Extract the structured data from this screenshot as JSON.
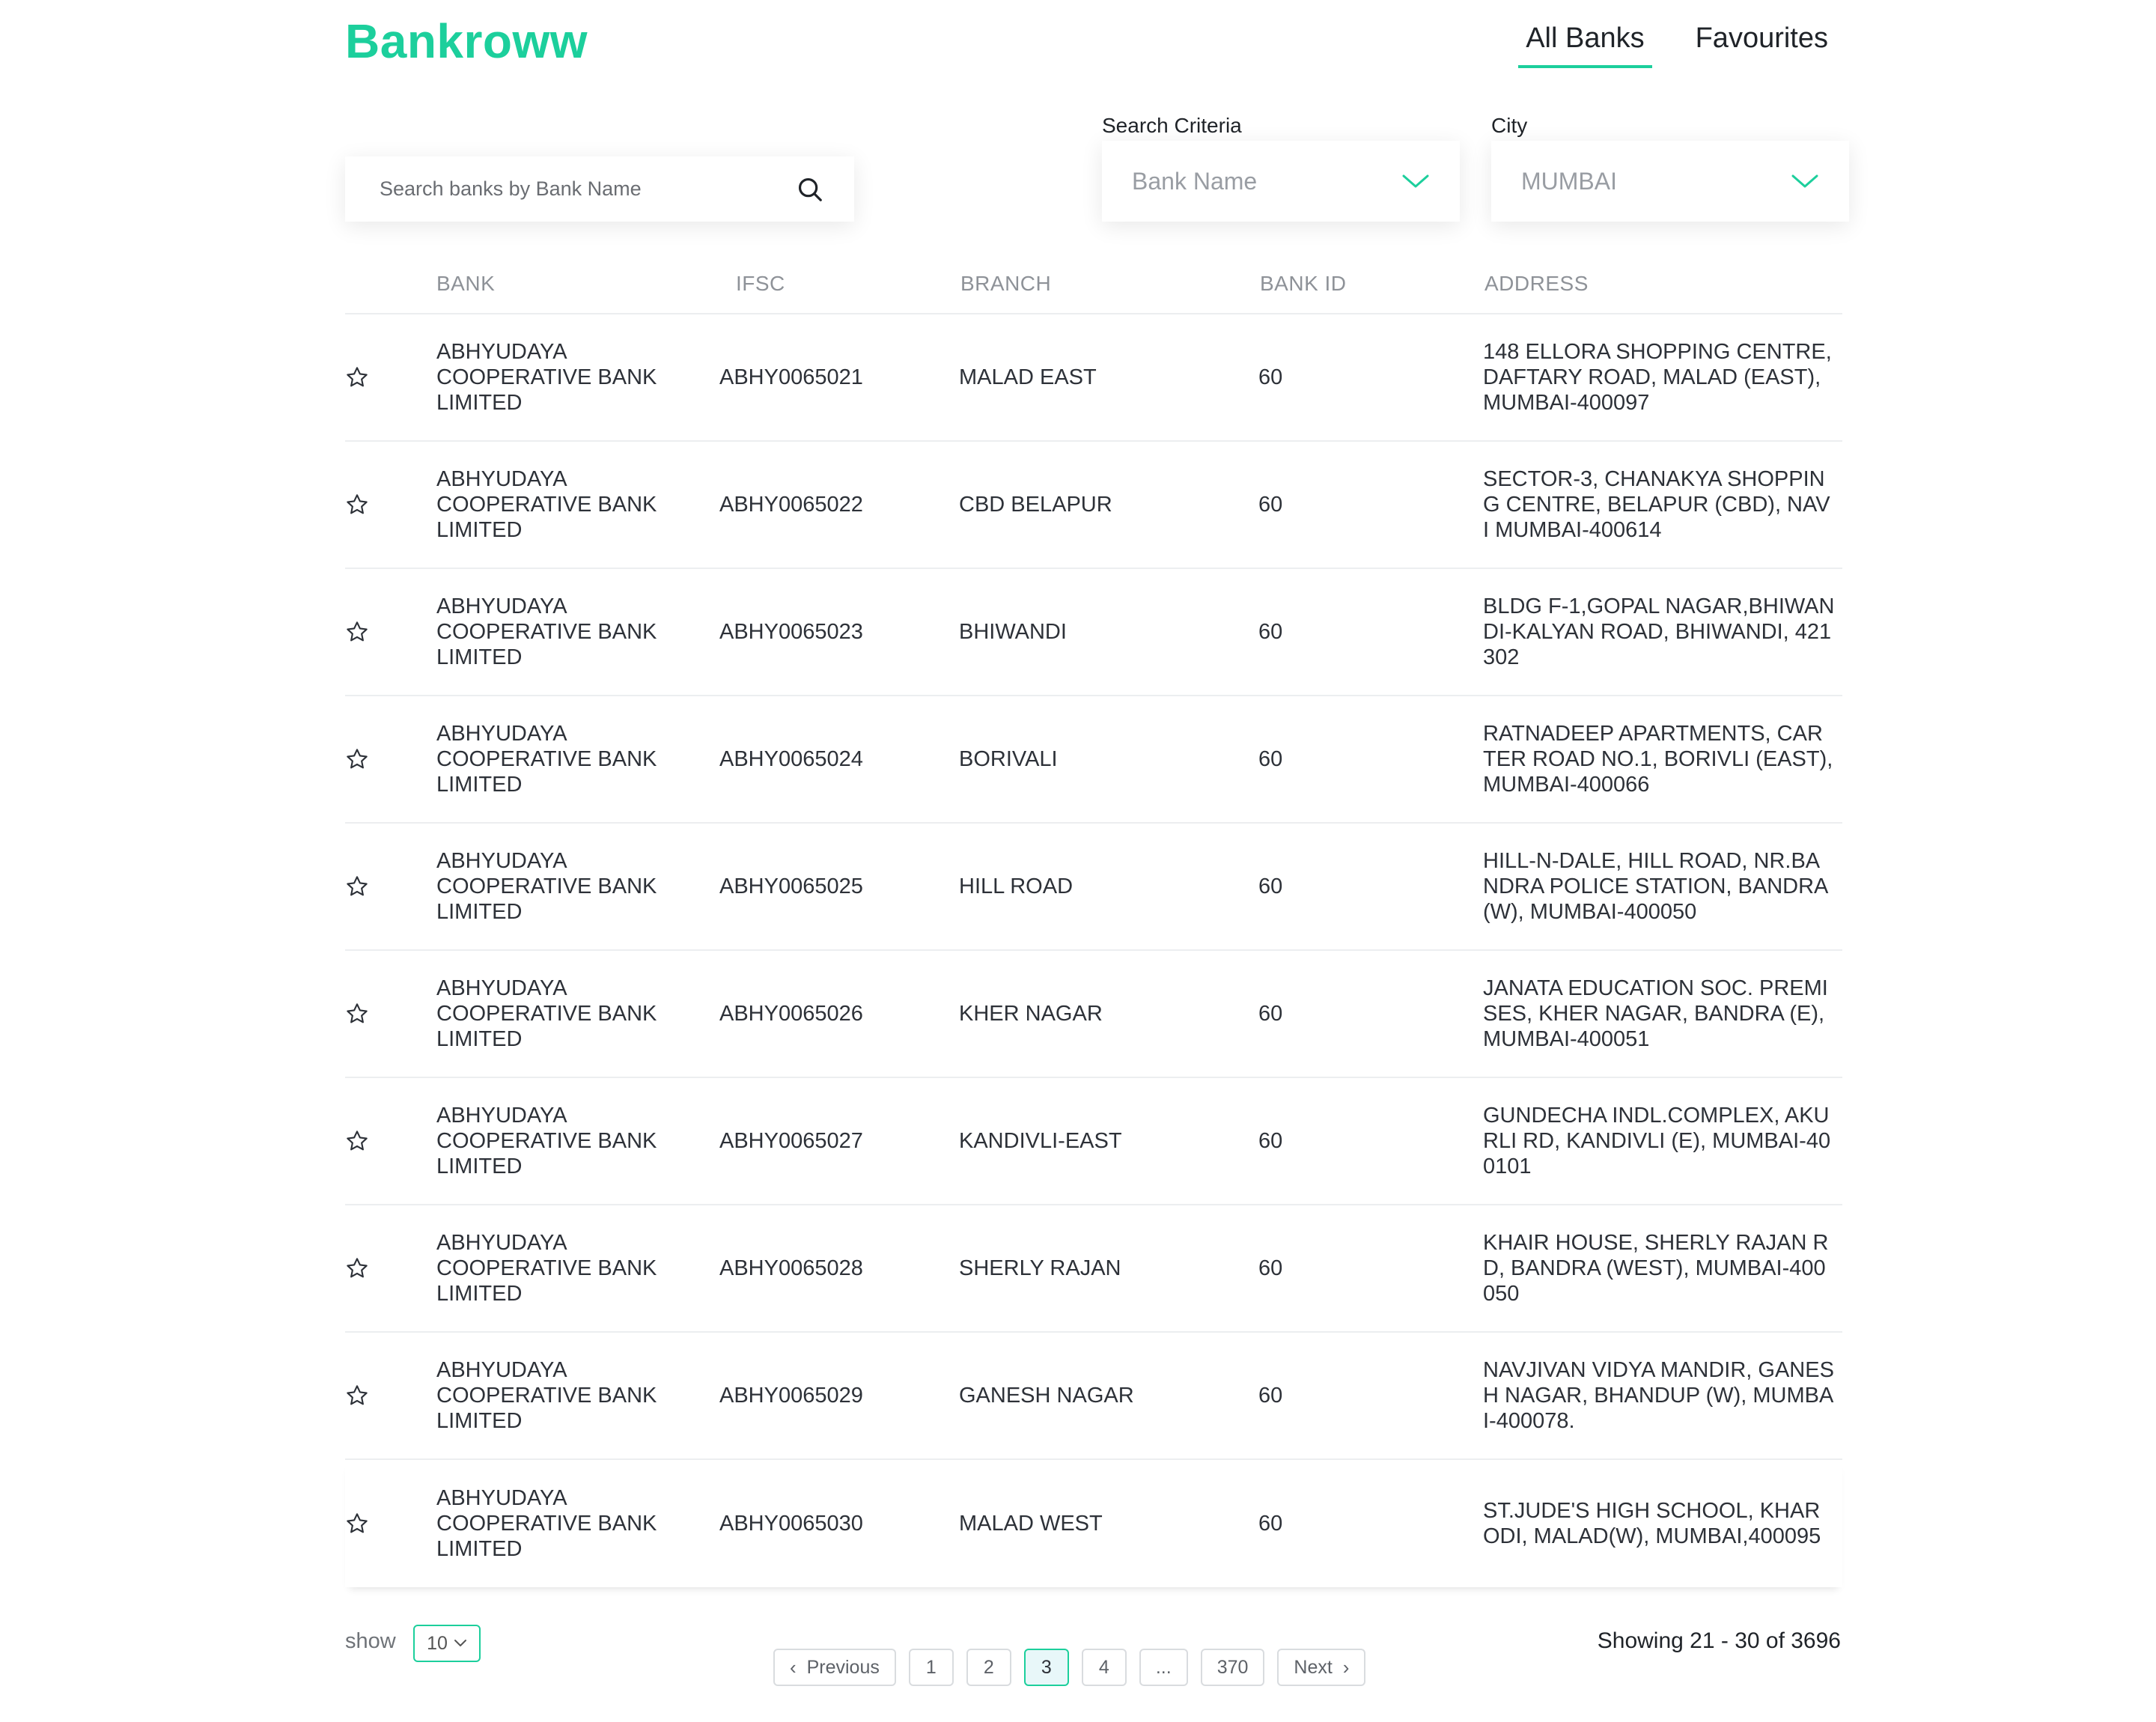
{
  "brand": "Bankroww",
  "nav": {
    "all_banks": "All Banks",
    "favourites": "Favourites"
  },
  "search": {
    "placeholder": "Search banks by Bank Name"
  },
  "filters": {
    "criteria_label": "Search Criteria",
    "criteria_value": "Bank Name",
    "city_label": "City",
    "city_value": "MUMBAI"
  },
  "table": {
    "headers": {
      "bank": "BANK",
      "ifsc": "IFSC",
      "branch": "BRANCH",
      "bank_id": "BANK ID",
      "address": "ADDRESS"
    },
    "rows": [
      {
        "bank": "ABHYUDAYA COOPERATIVE BANK LIMITED",
        "ifsc": "ABHY0065021",
        "branch": "MALAD EAST",
        "bank_id": "60",
        "address": "148 ELLORA SHOPPING CENTRE, DAFTARY ROAD, MALAD (EAST), MUMBAI-400097"
      },
      {
        "bank": "ABHYUDAYA COOPERATIVE BANK LIMITED",
        "ifsc": "ABHY0065022",
        "branch": "CBD BELAPUR",
        "bank_id": "60",
        "address": "SECTOR-3, CHANAKYA SHOPPING CENTRE, BELAPUR (CBD), NAVI MUMBAI-400614"
      },
      {
        "bank": "ABHYUDAYA COOPERATIVE BANK LIMITED",
        "ifsc": "ABHY0065023",
        "branch": "BHIWANDI",
        "bank_id": "60",
        "address": "BLDG F-1,GOPAL NAGAR,BHIWANDI-KALYAN ROAD, BHIWANDI, 421302"
      },
      {
        "bank": "ABHYUDAYA COOPERATIVE BANK LIMITED",
        "ifsc": "ABHY0065024",
        "branch": "BORIVALI",
        "bank_id": "60",
        "address": "RATNADEEP APARTMENTS, CARTER ROAD NO.1, BORIVLI (EAST), MUMBAI-400066"
      },
      {
        "bank": "ABHYUDAYA COOPERATIVE BANK LIMITED",
        "ifsc": "ABHY0065025",
        "branch": "HILL ROAD",
        "bank_id": "60",
        "address": "HILL-N-DALE, HILL ROAD, NR.BANDRA POLICE STATION, BANDRA (W), MUMBAI-400050"
      },
      {
        "bank": "ABHYUDAYA COOPERATIVE BANK LIMITED",
        "ifsc": "ABHY0065026",
        "branch": "KHER NAGAR",
        "bank_id": "60",
        "address": "JANATA EDUCATION SOC. PREMISES, KHER NAGAR, BANDRA (E), MUMBAI-400051"
      },
      {
        "bank": "ABHYUDAYA COOPERATIVE BANK LIMITED",
        "ifsc": "ABHY0065027",
        "branch": "KANDIVLI-EAST",
        "bank_id": "60",
        "address": "GUNDECHA INDL.COMPLEX, AKURLI RD, KANDIVLI (E), MUMBAI-400101"
      },
      {
        "bank": "ABHYUDAYA COOPERATIVE BANK LIMITED",
        "ifsc": "ABHY0065028",
        "branch": "SHERLY RAJAN",
        "bank_id": "60",
        "address": "KHAIR HOUSE, SHERLY RAJAN RD, BANDRA (WEST), MUMBAI-400050"
      },
      {
        "bank": "ABHYUDAYA COOPERATIVE BANK LIMITED",
        "ifsc": "ABHY0065029",
        "branch": "GANESH NAGAR",
        "bank_id": "60",
        "address": "NAVJIVAN VIDYA MANDIR, GANESH NAGAR, BHANDUP (W), MUMBAI-400078."
      },
      {
        "bank": "ABHYUDAYA COOPERATIVE BANK LIMITED",
        "ifsc": "ABHY0065030",
        "branch": "MALAD WEST",
        "bank_id": "60",
        "address": "ST.JUDE'S HIGH SCHOOL, KHARODI, MALAD(W), MUMBAI,400095"
      }
    ]
  },
  "footer": {
    "show_label": "show",
    "page_size": "10",
    "previous": "Previous",
    "next": "Next",
    "pages": [
      "1",
      "2",
      "3",
      "4",
      "...",
      "370"
    ],
    "current_page": "3",
    "showing": "Showing 21 - 30 of 3696"
  },
  "colors": {
    "accent": "#1ccf9c",
    "active_page_bg": "#e8f7f9"
  }
}
